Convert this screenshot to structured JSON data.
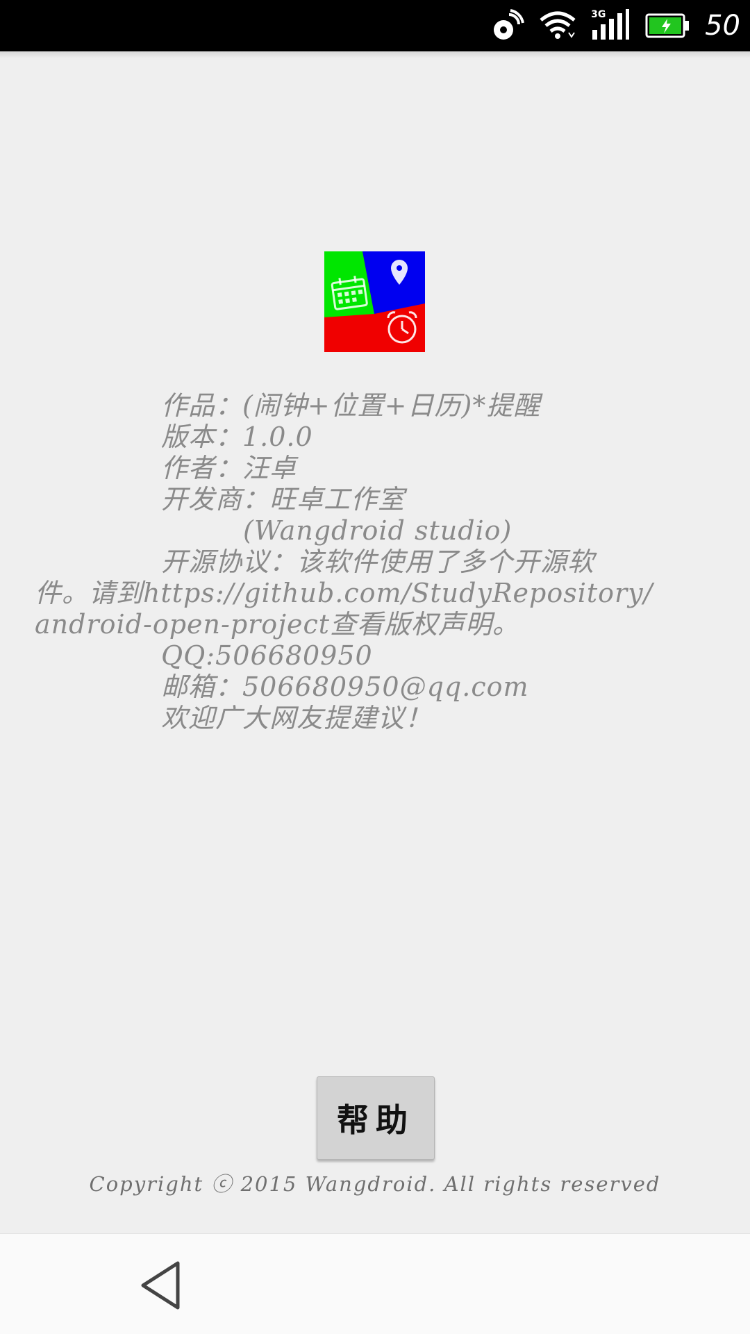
{
  "status_bar": {
    "network_label": "3G",
    "battery_level_text": "50"
  },
  "info": {
    "work_line": "作品：(闹钟+位置+日历)*提醒",
    "version_line": "版本：1.0.0",
    "author_line": "作者：汪卓",
    "developer_line": "开发商：旺卓工作室",
    "developer_en_line": "(Wangdroid studio)",
    "license_line_1": "开源协议：该软件使用了多个开源软",
    "license_line_2": "件。请到https://github.com/StudyRepository/",
    "license_line_3": "android-open-project查看版权声明。",
    "qq_line": "QQ:506680950",
    "email_line": "邮箱：506680950@qq.com",
    "welcome_line": "欢迎广大网友提建议！"
  },
  "help_button": {
    "label": "帮助"
  },
  "footer": {
    "copyright": "Copyright ⓒ 2015 Wangdroid. All rights reserved"
  },
  "colors": {
    "icon_green": "#00e600",
    "icon_blue": "#0000f0",
    "icon_red": "#f00000",
    "battery_green": "#22c51f"
  }
}
